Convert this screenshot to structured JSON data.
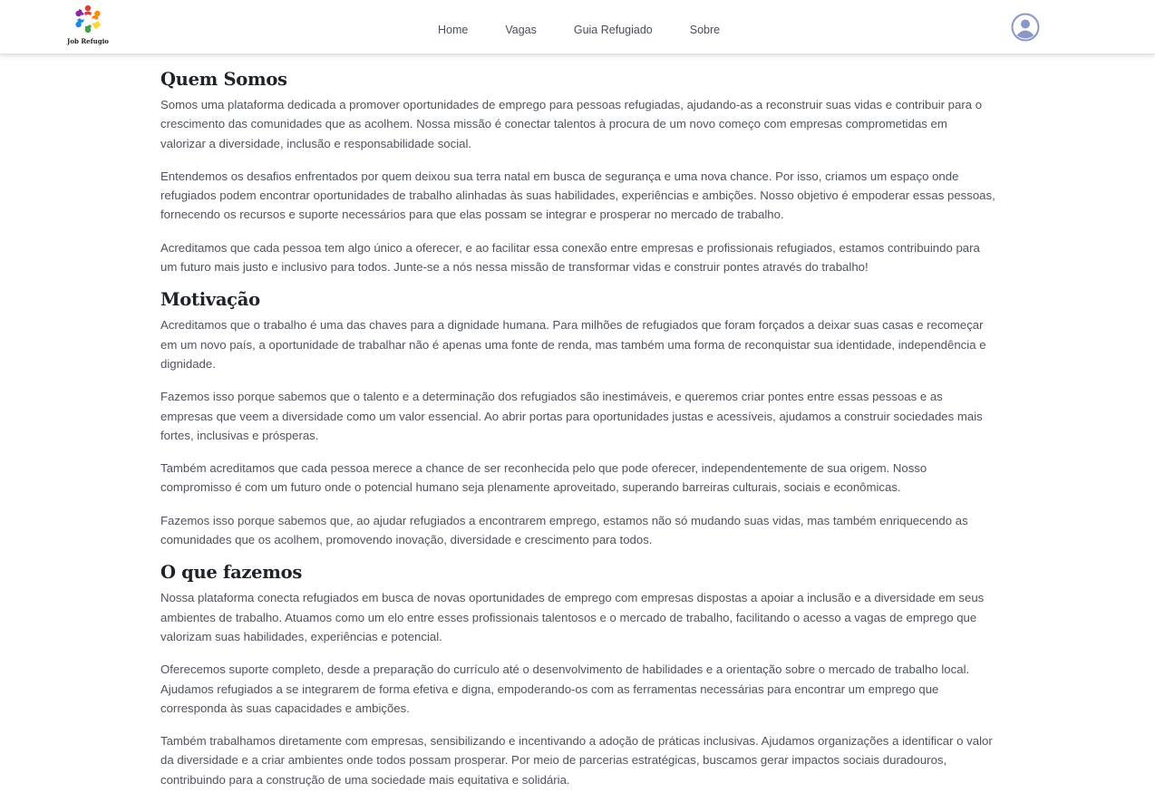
{
  "header": {
    "logo_text": "Job Refugio",
    "nav": [
      "Home",
      "Vagas",
      "Guia Refugiado",
      "Sobre"
    ]
  },
  "sections": [
    {
      "title": "Quem Somos",
      "paragraphs": [
        "Somos uma plataforma dedicada a promover oportunidades de emprego para pessoas refugiadas, ajudando-as a reconstruir suas vidas e contribuir para o crescimento das comunidades que as acolhem. Nossa missão é conectar talentos à procura de um novo começo com empresas comprometidas em valorizar a diversidade, inclusão e responsabilidade social.",
        "Entendemos os desafios enfrentados por quem deixou sua terra natal em busca de segurança e uma nova chance. Por isso, criamos um espaço onde refugiados podem encontrar oportunidades de trabalho alinhadas às suas habilidades, experiências e ambições. Nosso objetivo é empoderar essas pessoas, fornecendo os recursos e suporte necessários para que elas possam se integrar e prosperar no mercado de trabalho.",
        "Acreditamos que cada pessoa tem algo único a oferecer, e ao facilitar essa conexão entre empresas e profissionais refugiados, estamos contribuindo para um futuro mais justo e inclusivo para todos. Junte-se a nós nessa missão de transformar vidas e construir pontes através do trabalho!"
      ]
    },
    {
      "title": "Motivação",
      "paragraphs": [
        "Acreditamos que o trabalho é uma das chaves para a dignidade humana. Para milhões de refugiados que foram forçados a deixar suas casas e recomeçar em um novo país, a oportunidade de trabalhar não é apenas uma fonte de renda, mas também uma forma de reconquistar sua identidade, independência e dignidade.",
        "Fazemos isso porque sabemos que o talento e a determinação dos refugiados são inestimáveis, e queremos criar pontes entre essas pessoas e as empresas que veem a diversidade como um valor essencial. Ao abrir portas para oportunidades justas e acessíveis, ajudamos a construir sociedades mais fortes, inclusivas e prósperas.",
        "Também acreditamos que cada pessoa merece a chance de ser reconhecida pelo que pode oferecer, independentemente de sua origem. Nosso compromisso é com um futuro onde o potencial humano seja plenamente aproveitado, superando barreiras culturais, sociais e econômicas.",
        "Fazemos isso porque sabemos que, ao ajudar refugiados a encontrarem emprego, estamos não só mudando suas vidas, mas também enriquecendo as comunidades que os acolhem, promovendo inovação, diversidade e crescimento para todos."
      ]
    },
    {
      "title": "O que fazemos",
      "paragraphs": [
        "Nossa plataforma conecta refugiados em busca de novas oportunidades de emprego com empresas dispostas a apoiar a inclusão e a diversidade em seus ambientes de trabalho. Atuamos como um elo entre esses profissionais talentosos e o mercado de trabalho, facilitando o acesso a vagas de emprego que valorizam suas habilidades, experiências e potencial.",
        "Oferecemos suporte completo, desde a preparação do currículo até o desenvolvimento de habilidades e a orientação sobre o mercado de trabalho local. Ajudamos refugiados a se integrarem de forma efetiva e digna, empoderando-os com as ferramentas necessárias para encontrar um emprego que corresponda às suas capacidades e ambições.",
        "Também trabalhamos diretamente com empresas, sensibilizando e incentivando a adoção de práticas inclusivas. Ajudamos organizações a identificar o valor da diversidade e a criar ambientes onde todos possam prosperar. Por meio de parcerias estratégicas, buscamos gerar impactos sociais duradouros, contribuindo para a construção de uma sociedade mais equitativa e solidária."
      ]
    }
  ],
  "icons": {
    "logo": "job-refugio-logo",
    "avatar": "user-avatar-icon"
  },
  "colors": {
    "avatar": "#8a97c9",
    "heading": "#1f2329",
    "text": "#4f545c"
  }
}
